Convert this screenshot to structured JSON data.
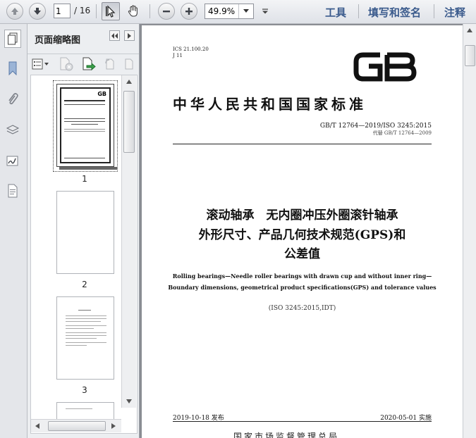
{
  "toolbar": {
    "current_page": "1",
    "page_total": "/ 16",
    "zoom": "49.9%",
    "menu_tools": "工具",
    "menu_sign": "填写和签名",
    "menu_comment": "注释"
  },
  "panel": {
    "title": "页面缩略图",
    "thumbnails": [
      {
        "label": "1"
      },
      {
        "label": "2"
      },
      {
        "label": "3"
      }
    ]
  },
  "document": {
    "ics": "ICS 21.100.20",
    "ccs": "J 11",
    "logo": "GB",
    "standard_name": "中华人民共和国国家标准",
    "code": "GB/T 12764—2019/ISO 3245:2015",
    "replaces": "代替 GB/T 12764—2009",
    "title_line1": "滚动轴承　无内圈冲压外圈滚针轴承",
    "title_line2": "外形尺寸、产品几何技术规范(GPS)和",
    "title_line3": "公差值",
    "en_line1": "Rolling bearings—Needle roller bearings with drawn cup and without inner ring—",
    "en_line2": "Boundary dimensions, geometrical product specifications(GPS) and tolerance values",
    "iso_ref": "(ISO 3245:2015,IDT)",
    "publish_date": "2019-10-18 发布",
    "effective_date": "2020-05-01 实施",
    "issuer": "国家市场监督管理总局"
  },
  "colors": {
    "accent": "#3a5a8c",
    "toolbar_bg": "#e6e8ec",
    "doc_bg": "#8a8d93"
  }
}
